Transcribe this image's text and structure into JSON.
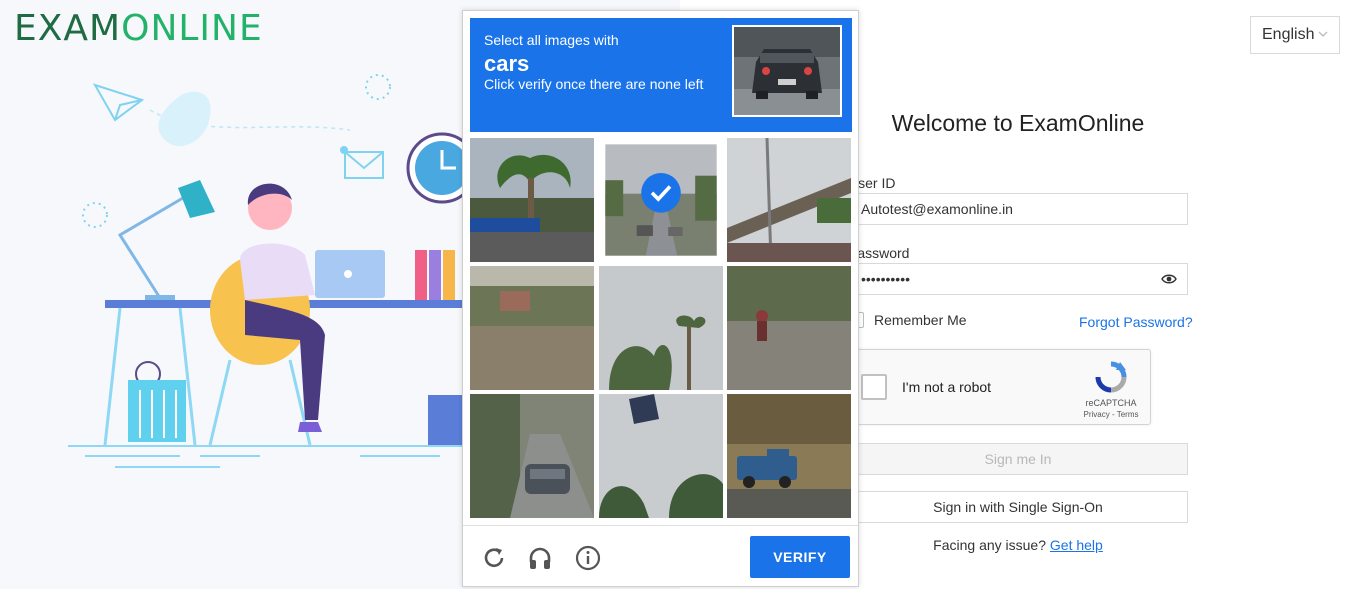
{
  "brand": {
    "logo_part1": "EXAM",
    "logo_part2": "ONLINE"
  },
  "language": {
    "selected": "English"
  },
  "login": {
    "heading": "Welcome to ExamOnline",
    "user_id_label": "User ID",
    "user_id_value": "Autotest@examonline.in",
    "password_label": "Password",
    "password_value": "••••••••••",
    "remember_me": "Remember Me",
    "forgot_password": "Forgot Password?",
    "sign_in": "Sign me In",
    "sso": "Sign in with Single Sign-On",
    "help_prefix": "Facing any issue?",
    "help_link": "Get help"
  },
  "recaptcha_widget": {
    "label": "I'm not a robot",
    "brand": "reCAPTCHA",
    "terms": "Privacy - Terms"
  },
  "captcha_challenge": {
    "instruction_line1": "Select all images with",
    "target": "cars",
    "instruction_line3": "Click verify once there are none left",
    "verify_label": "VERIFY",
    "tiles": [
      {
        "content": "palm tree gas station",
        "selected": false
      },
      {
        "content": "road with cars",
        "selected": true
      },
      {
        "content": "highway overpass",
        "selected": false
      },
      {
        "content": "bushes",
        "selected": false
      },
      {
        "content": "palm trees",
        "selected": false
      },
      {
        "content": "cyclist on street",
        "selected": false
      },
      {
        "content": "parked car",
        "selected": false
      },
      {
        "content": "sign and trees",
        "selected": false
      },
      {
        "content": "blue pickup truck",
        "selected": false
      }
    ]
  },
  "colors": {
    "accent": "#1a73e8",
    "logo_dark": "#1f6b43",
    "logo_light": "#23b26a"
  }
}
